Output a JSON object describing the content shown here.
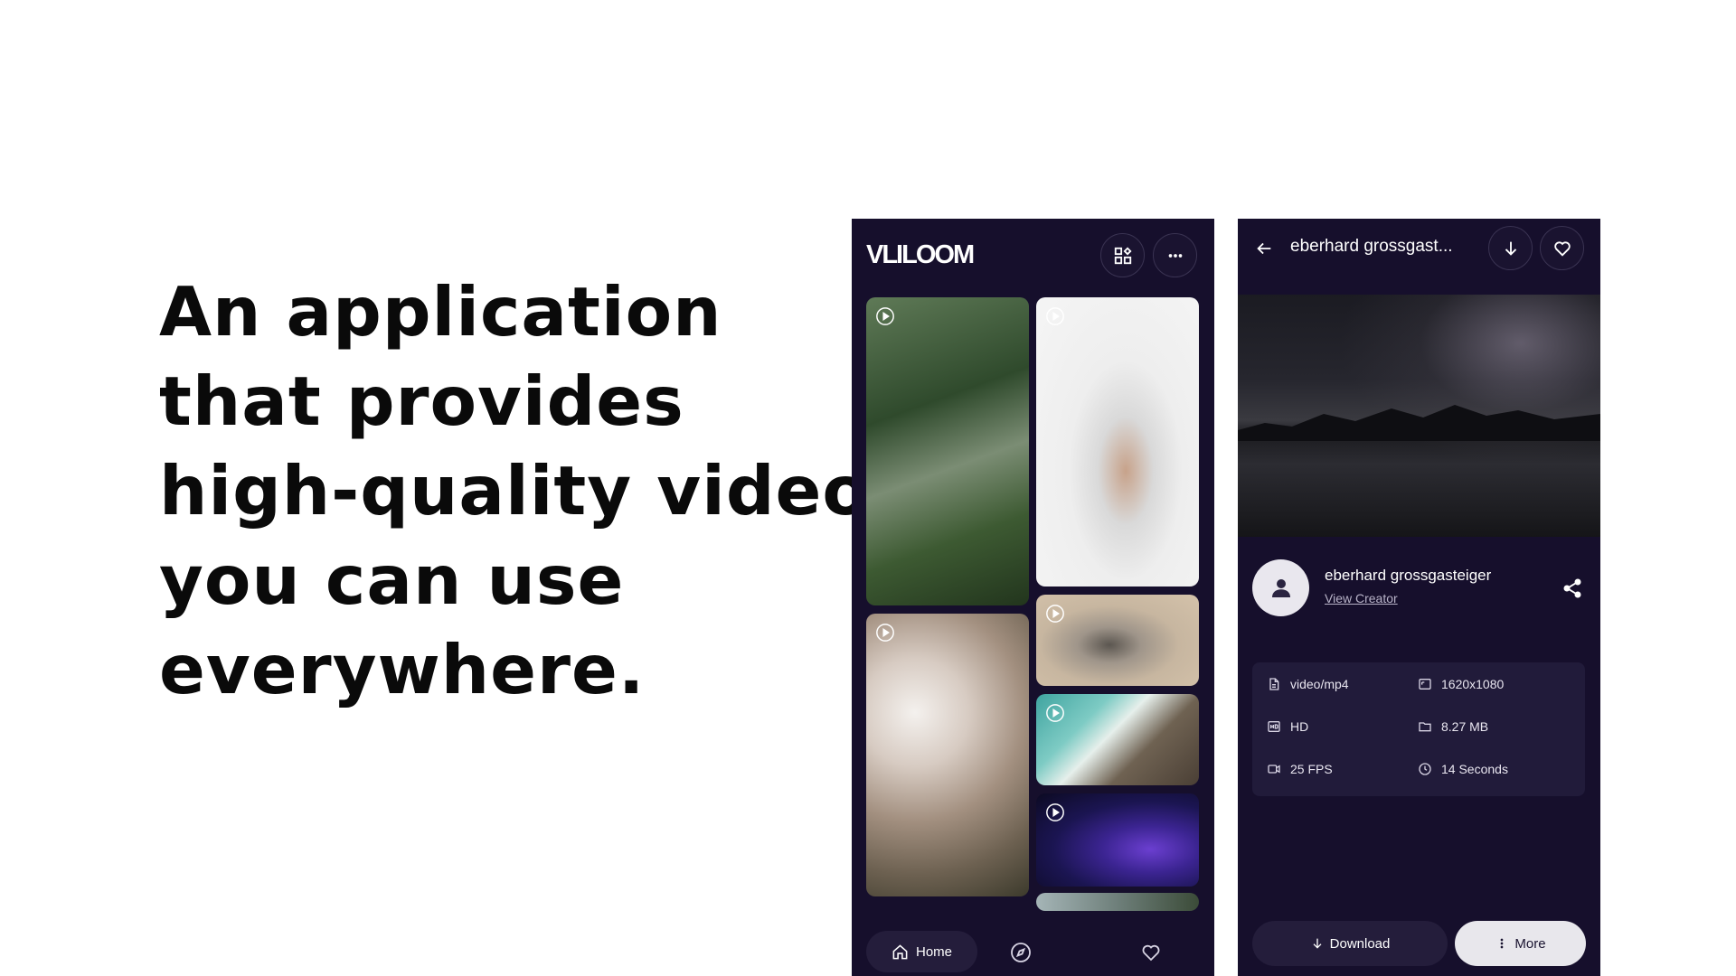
{
  "headline": {
    "lines": [
      "An application",
      "that provides",
      "high-quality videos",
      "you can use",
      "everywhere."
    ]
  },
  "feed_screen": {
    "logo": "VLILOOM",
    "icons": [
      "grid-icon",
      "more-horizontal-icon"
    ],
    "tiles": [
      "forest-video",
      "seedling-video",
      "blossom-video",
      "seal-video",
      "coast-video",
      "particles-video",
      "landscape-video"
    ],
    "bottom_nav": {
      "home_label": "Home",
      "icons": [
        "home-icon",
        "compass-icon",
        "heart-icon"
      ]
    }
  },
  "detail_screen": {
    "title": "eberhard grossgast...",
    "creator": {
      "name": "eberhard grossgasteiger",
      "link_label": "View Creator"
    },
    "info": {
      "format": "video/mp4",
      "resolution": "1620x1080",
      "quality": "HD",
      "size": "8.27 MB",
      "fps": "25 FPS",
      "duration": "14 Seconds"
    },
    "actions": {
      "download_label": "Download",
      "more_label": "More"
    }
  },
  "colors": {
    "app_bg": "#160f2c",
    "card_bg": "#211b3a",
    "accent_light": "#e8e7ec"
  }
}
